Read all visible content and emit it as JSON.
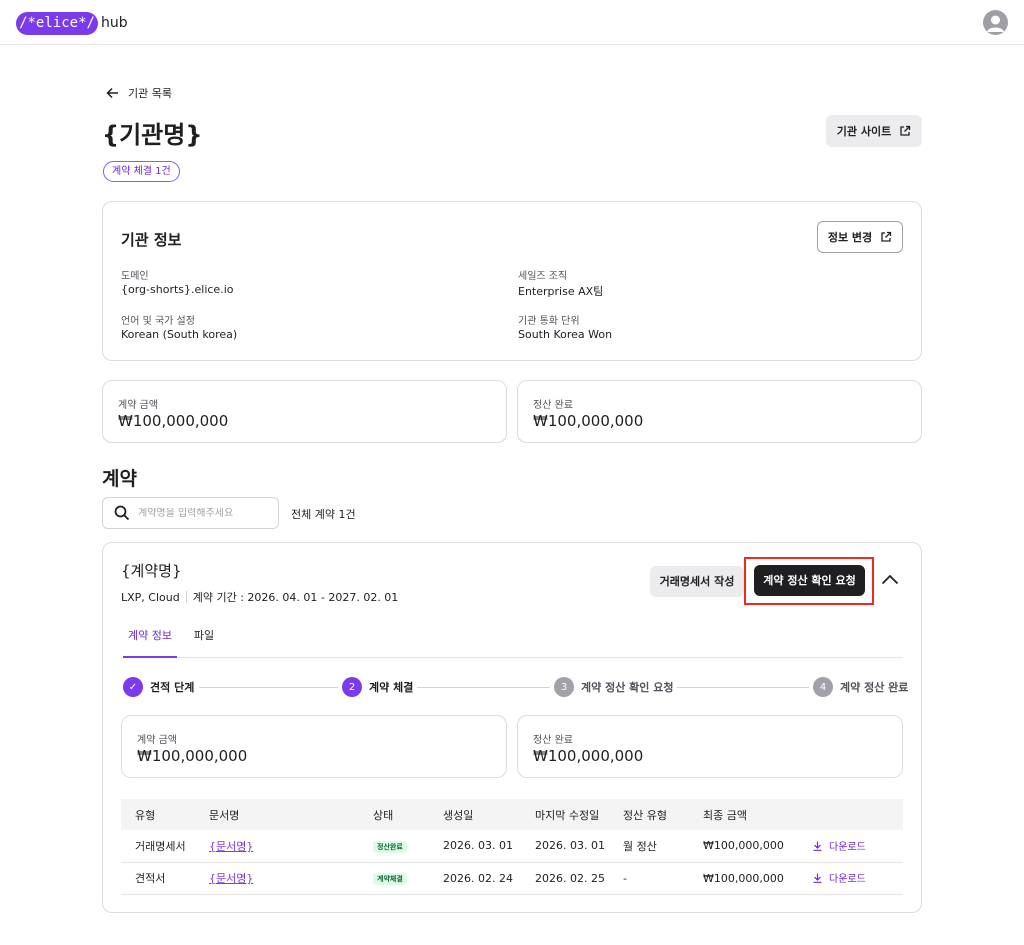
{
  "header": {
    "logo_text": "/*elice*/",
    "logo_suffix": "hub",
    "accent_color": "#7c3aed"
  },
  "page": {
    "back_label": "기관 목록",
    "title": "{기관명}",
    "site_button_label": "기관 사이트",
    "contract_badge": "계약 체결 1건"
  },
  "org_info": {
    "title": "기관 정보",
    "edit_button_label": "정보 변경",
    "fields": [
      {
        "label": "도메인",
        "value": "{org-shorts}.elice.io"
      },
      {
        "label": "세일즈 조직",
        "value": "Enterprise AX팀"
      },
      {
        "label": "언어 및 국가 설정",
        "value": "Korean (South korea)"
      },
      {
        "label": "기관 통화 단위",
        "value": "South Korea Won"
      }
    ]
  },
  "summary": [
    {
      "label": "계약 금액",
      "value": "₩100,000,000"
    },
    {
      "label": "정산 완료",
      "value": "₩100,000,000"
    }
  ],
  "contracts_section": {
    "title": "계약",
    "search_placeholder": "계약명을 입력해주세요",
    "total_count": "전체 계약 1건"
  },
  "contract": {
    "name": "{계약명}",
    "products": "LXP, Cloud",
    "period": "계약 기간 : 2026. 04. 01 - 2027. 02. 01",
    "doc_button_label": "거래명세서 작성",
    "request_button_label": "계약 정산 확인 요청",
    "tabs": [
      {
        "label": "계약 정보"
      },
      {
        "label": "파일"
      }
    ],
    "steps": [
      {
        "number": "✓",
        "label": "견적 단계"
      },
      {
        "number": "2",
        "label": "계약 체결"
      },
      {
        "number": "3",
        "label": "계약 정산 확인 요청"
      },
      {
        "number": "4",
        "label": "계약 정산 완료"
      }
    ],
    "summary": [
      {
        "label": "계약 금액",
        "value": "₩100,000,000"
      },
      {
        "label": "정산 완료",
        "value": "₩100,000,000"
      }
    ],
    "table": {
      "headers": [
        "유형",
        "문서명",
        "상태",
        "생성일",
        "마지막 수정일",
        "정산 유형",
        "최종 금액",
        ""
      ],
      "rows": [
        {
          "type": "거래명세서",
          "doc": "{문서명}",
          "status": "정산완료",
          "created": "2026. 03. 01",
          "modified": "2026. 03. 01",
          "settle": "월 정산",
          "amount": "₩100,000,000",
          "action": "다운로드"
        },
        {
          "type": "견적서",
          "doc": "{문서명}",
          "status": "계약체결",
          "created": "2026. 02. 24",
          "modified": "2026. 02. 25",
          "settle": "-",
          "amount": "₩100,000,000",
          "action": "다운로드"
        }
      ]
    }
  }
}
